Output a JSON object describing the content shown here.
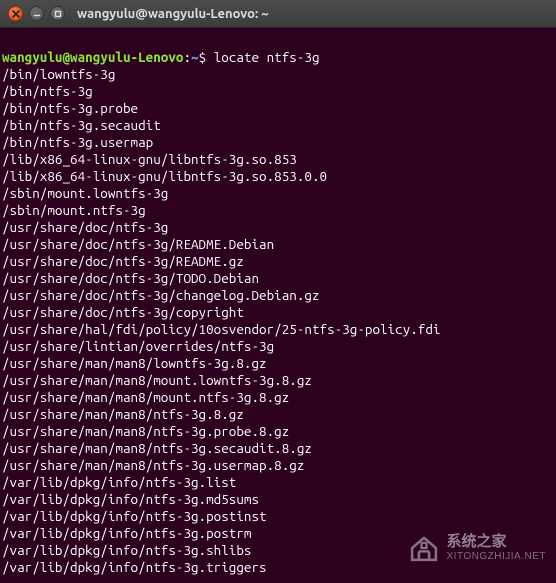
{
  "window": {
    "title": "wangyulu@wangyulu-Lenovo: ~"
  },
  "prompt": {
    "user_host": "wangyulu@wangyulu-Lenovo",
    "separator": ":",
    "path": "~",
    "symbol": "$"
  },
  "command": "locate ntfs-3g",
  "output": [
    "/bin/lowntfs-3g",
    "/bin/ntfs-3g",
    "/bin/ntfs-3g.probe",
    "/bin/ntfs-3g.secaudit",
    "/bin/ntfs-3g.usermap",
    "/lib/x86_64-linux-gnu/libntfs-3g.so.853",
    "/lib/x86_64-linux-gnu/libntfs-3g.so.853.0.0",
    "/sbin/mount.lowntfs-3g",
    "/sbin/mount.ntfs-3g",
    "/usr/share/doc/ntfs-3g",
    "/usr/share/doc/ntfs-3g/README.Debian",
    "/usr/share/doc/ntfs-3g/README.gz",
    "/usr/share/doc/ntfs-3g/TODO.Debian",
    "/usr/share/doc/ntfs-3g/changelog.Debian.gz",
    "/usr/share/doc/ntfs-3g/copyright",
    "/usr/share/hal/fdi/policy/10osvendor/25-ntfs-3g-policy.fdi",
    "/usr/share/lintian/overrides/ntfs-3g",
    "/usr/share/man/man8/lowntfs-3g.8.gz",
    "/usr/share/man/man8/mount.lowntfs-3g.8.gz",
    "/usr/share/man/man8/mount.ntfs-3g.8.gz",
    "/usr/share/man/man8/ntfs-3g.8.gz",
    "/usr/share/man/man8/ntfs-3g.probe.8.gz",
    "/usr/share/man/man8/ntfs-3g.secaudit.8.gz",
    "/usr/share/man/man8/ntfs-3g.usermap.8.gz",
    "/var/lib/dpkg/info/ntfs-3g.list",
    "/var/lib/dpkg/info/ntfs-3g.md5sums",
    "/var/lib/dpkg/info/ntfs-3g.postinst",
    "/var/lib/dpkg/info/ntfs-3g.postrm",
    "/var/lib/dpkg/info/ntfs-3g.shlibs",
    "/var/lib/dpkg/info/ntfs-3g.triggers"
  ],
  "watermark": {
    "main": "系统之家",
    "sub": "XITONGZHIJIA.NET"
  }
}
